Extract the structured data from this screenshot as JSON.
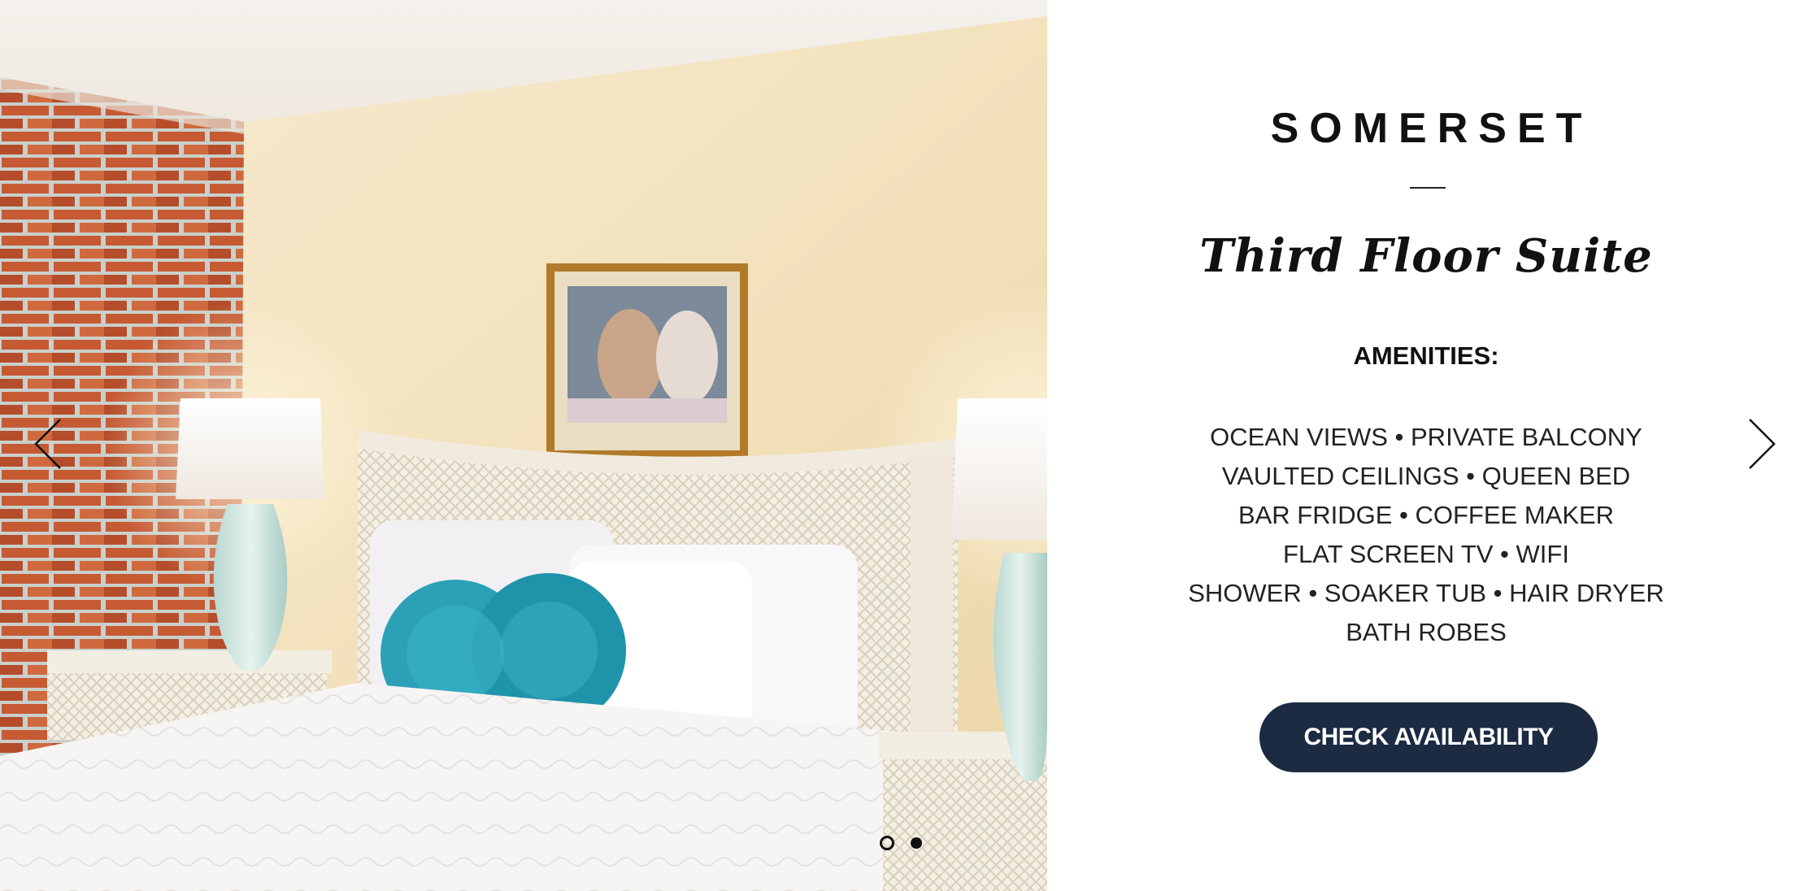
{
  "room": {
    "name": "SOMERSET",
    "subtitle": "Third Floor Suite"
  },
  "amenities": {
    "heading": "AMENITIES:",
    "lines": [
      "OCEAN VIEWS • PRIVATE BALCONY",
      "VAULTED CEILINGS • QUEEN BED",
      "BAR FRIDGE • COFFEE MAKER",
      "FLAT SCREEN TV • WIFI",
      "SHOWER • SOAKER TUB • HAIR DRYER",
      "BATH ROBES"
    ]
  },
  "cta": {
    "label": "CHECK AVAILABILITY"
  },
  "slider": {
    "icons": {
      "prev": "chevron-left-icon",
      "next": "chevron-right-icon"
    },
    "dots": [
      "active",
      "inactive"
    ]
  },
  "colors": {
    "button_bg": "#1c2a42",
    "button_text": "#ffffff",
    "text": "#111111",
    "background": "#ffffff"
  }
}
